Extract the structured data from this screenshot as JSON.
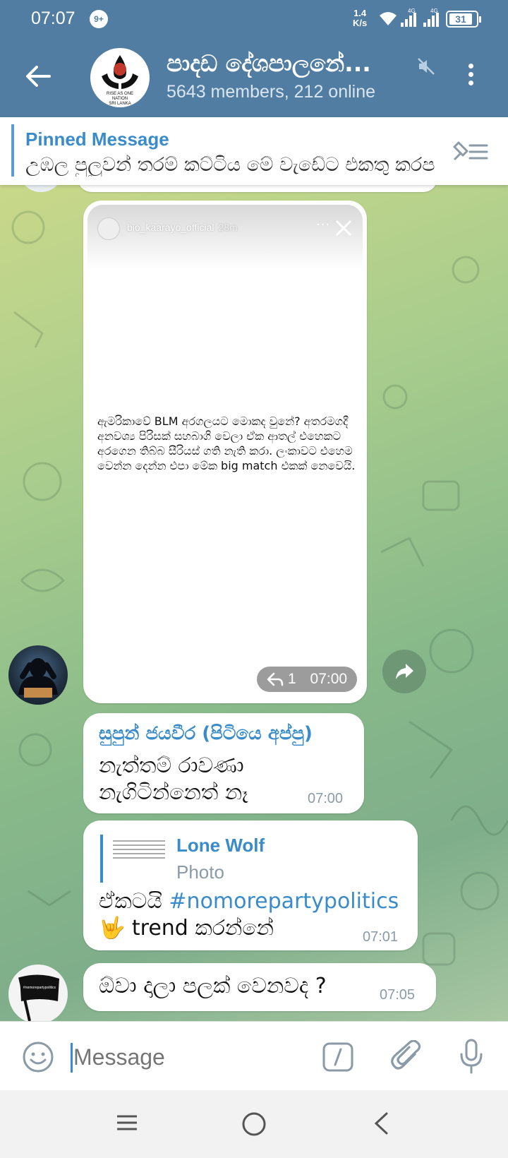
{
  "status_bar": {
    "time": "07:07",
    "notification_badge": "9+",
    "net_speed_value": "1.4",
    "net_speed_unit": "K/s",
    "sim1": "4G",
    "sim2": "4G",
    "battery": "31"
  },
  "header": {
    "title": "පාදඩ දේශපාලනේ...",
    "subtitle": "5643 members, 212 online",
    "avatar_text": [
      "RISE AS ONE",
      "NATION",
      "SRI LANKA"
    ]
  },
  "pinned": {
    "label": "Pinned Message",
    "text": "උඹල පුලුවන් තරම් කට්ටිය මේ වැඩේට එකතු කරපල්ලා"
  },
  "messages": {
    "story": {
      "account": "bio_kaarayo_official",
      "age": "28m",
      "text": "ඇමරිකාවේ BLM අරගලයට මොකද වුනේ? අතරමගදී අනවශ්‍ය පිරිසක් සහබාගි වෙලා ඒක ආතල් එහෙකට අරගෙන තිබ්බ සීරියස් ගති නැති කරා. ලංකාවට එහෙම වෙන්න දෙන්න එපා මේක big match එකක් නෙවෙයි.",
      "replies": "1",
      "time": "07:00"
    },
    "msg2": {
      "sender": "සුපුන් ජයවීර (පිටියෙ අප්පු)",
      "line1": "නැත්තම් රාවණා",
      "line2": "නැගිටින්නෙත් නෑ",
      "time": "07:00"
    },
    "msg3": {
      "reply_name": "Lone Wolf",
      "reply_type": "Photo",
      "text_prefix": "ඒකටයි ",
      "hashtag": "#nomorepartypolitics",
      "emoji": "🤟",
      "text_suffix": " trend කරන්නේ",
      "time": "07:01"
    },
    "msg4": {
      "text": "ඕවා දාලා පලක් වෙනවද ?",
      "time": "07:05"
    },
    "flag_avatar_text": "#nomorepartypolitics"
  },
  "composer": {
    "placeholder": "Message"
  },
  "colors": {
    "header": "#517da2",
    "accent": "#3a8bc9"
  }
}
